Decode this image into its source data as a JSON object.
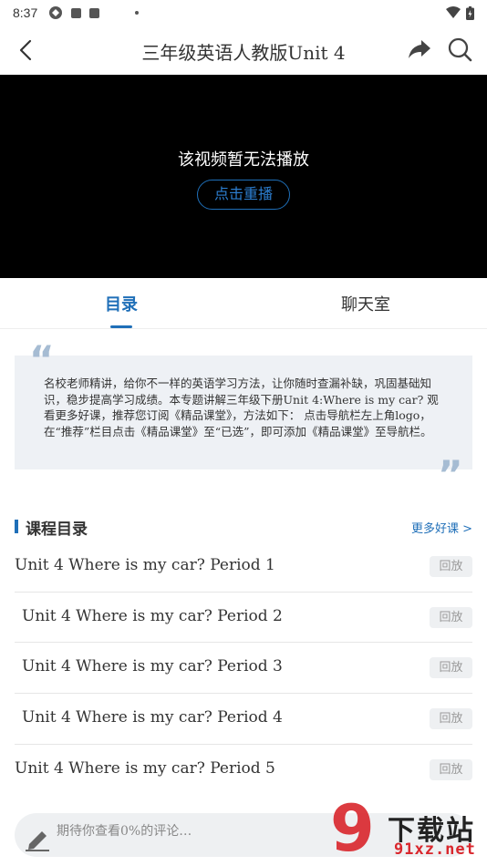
{
  "status_bar": {
    "time": "8:37"
  },
  "header": {
    "title": "三年级英语人教版Unit  4"
  },
  "video": {
    "message": "该视频暂无法播放",
    "replay_label": "点击重播"
  },
  "tabs": [
    {
      "label": "目录",
      "active": true
    },
    {
      "label": "聊天室",
      "active": false
    }
  ],
  "intro": {
    "text": "名校老师精讲，给你不一样的英语学习方法，让你随时查漏补缺，巩固基础知识，稳步提高学习成绩。本专题讲解三年级下册Unit 4:Where is my car? 观看更多好课，推荐您订阅《精品课堂》，方法如下： 点击导航栏左上角logo，在“推荐”栏目点击《精品课堂》至“已选”，即可添加《精品课堂》至导航栏。",
    "quote_open": "“",
    "quote_close": "”"
  },
  "catalog": {
    "title": "课程目录",
    "more_label": "更多好课  >"
  },
  "lessons": [
    {
      "title": "Unit  4  Where  is  my  car?  Period  1",
      "replay": "回放"
    },
    {
      "title": "Unit  4  Where  is  my  car?  Period  2",
      "replay": "回放"
    },
    {
      "title": "Unit  4  Where  is  my  car?  Period  3",
      "replay": "回放"
    },
    {
      "title": "Unit  4  Where  is  my  car?  Period  4",
      "replay": "回放"
    },
    {
      "title": "Unit  4  Where  is  my  car?  Period  5",
      "replay": "回放"
    }
  ],
  "comment": {
    "placeholder": "期待你查看0%的评论…"
  },
  "watermark": {
    "nine": "9",
    "text": "下载站",
    "url": "91xz.net"
  },
  "colors": {
    "accent": "#1f6fb8",
    "watermark_red": "#d9262c"
  }
}
